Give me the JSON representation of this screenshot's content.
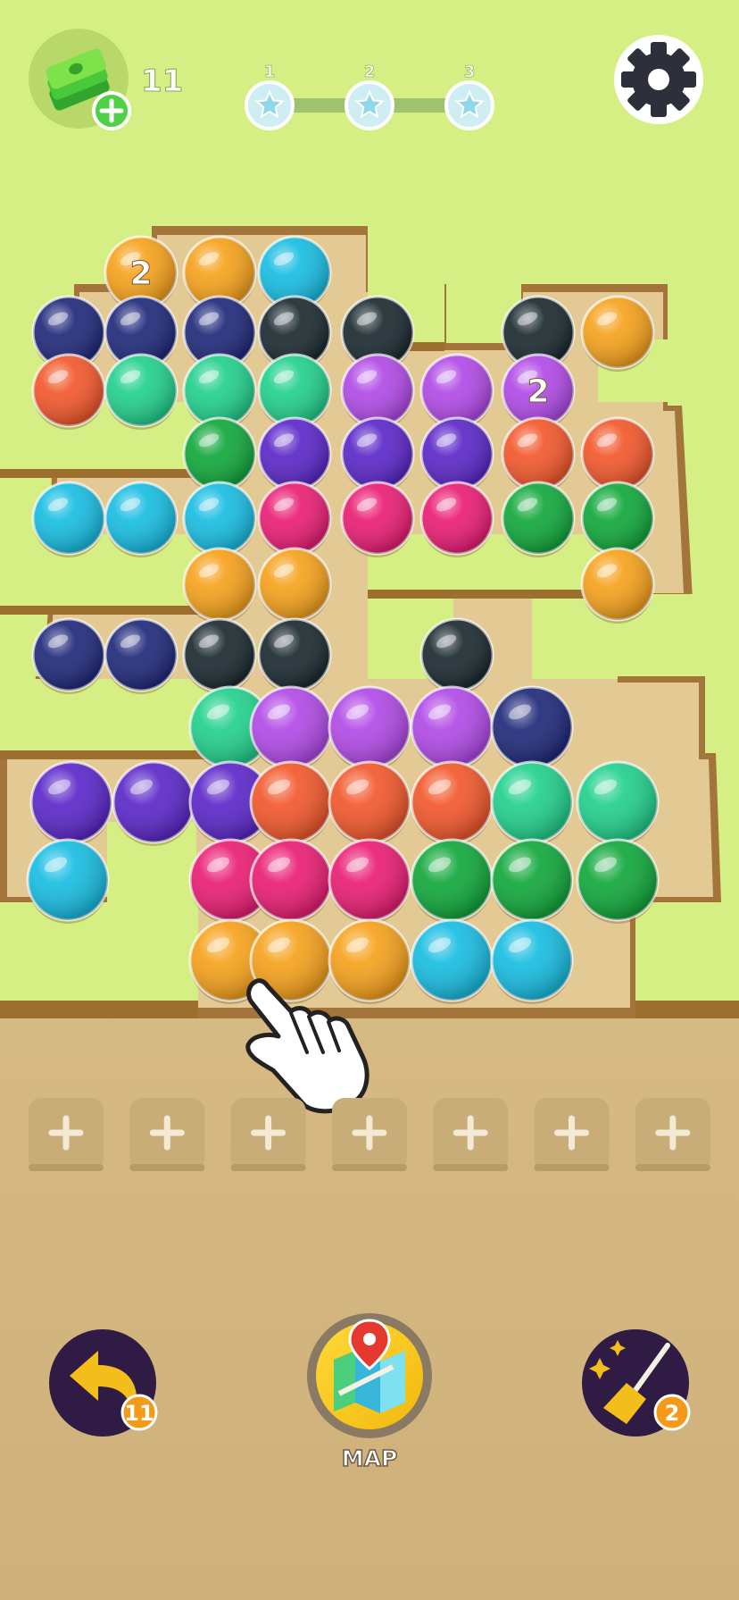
{
  "currency": {
    "amount": "11",
    "icon": "cash-stack-icon",
    "add_icon": "plus-icon"
  },
  "progress": {
    "stars": [
      {
        "label": "1"
      },
      {
        "label": "2"
      },
      {
        "label": "3"
      }
    ],
    "stars_earned": 0
  },
  "settings": {
    "icon": "gear-icon"
  },
  "board": {
    "colors": {
      "N": "#20297a",
      "K": "#1b2a30",
      "C": "#18bde2",
      "Y": "#f6a21c",
      "O": "#f2582c",
      "T": "#22d08d",
      "G": "#12a83c",
      "P": "#b14ae6",
      "V": "#5b27c8",
      "M": "#ea1e74"
    },
    "balls": [
      {
        "c": "Y",
        "row": 0,
        "col": 2,
        "badge": "2"
      },
      {
        "c": "Y",
        "row": 0,
        "col": 3
      },
      {
        "c": "C",
        "row": 0,
        "col": 4
      },
      {
        "c": "N",
        "row": 1,
        "col": 1
      },
      {
        "c": "N",
        "row": 1,
        "col": 2
      },
      {
        "c": "N",
        "row": 1,
        "col": 3
      },
      {
        "c": "K",
        "row": 1,
        "col": 4
      },
      {
        "c": "K",
        "row": 1,
        "col": 5
      },
      {
        "c": "K",
        "row": 1,
        "col": 7
      },
      {
        "c": "Y",
        "row": 1,
        "col": 8
      },
      {
        "c": "O",
        "row": 2,
        "col": 1
      },
      {
        "c": "T",
        "row": 2,
        "col": 2
      },
      {
        "c": "T",
        "row": 2,
        "col": 3
      },
      {
        "c": "T",
        "row": 2,
        "col": 4
      },
      {
        "c": "P",
        "row": 2,
        "col": 5
      },
      {
        "c": "P",
        "row": 2,
        "col": 6
      },
      {
        "c": "P",
        "row": 2,
        "col": 7,
        "badge": "2"
      },
      {
        "c": "G",
        "row": 3,
        "col": 3
      },
      {
        "c": "V",
        "row": 3,
        "col": 4
      },
      {
        "c": "V",
        "row": 3,
        "col": 5
      },
      {
        "c": "V",
        "row": 3,
        "col": 6
      },
      {
        "c": "O",
        "row": 3,
        "col": 7
      },
      {
        "c": "O",
        "row": 3,
        "col": 8
      },
      {
        "c": "C",
        "row": 4,
        "col": 1
      },
      {
        "c": "C",
        "row": 4,
        "col": 2
      },
      {
        "c": "C",
        "row": 4,
        "col": 3
      },
      {
        "c": "M",
        "row": 4,
        "col": 4
      },
      {
        "c": "M",
        "row": 4,
        "col": 5
      },
      {
        "c": "M",
        "row": 4,
        "col": 6
      },
      {
        "c": "G",
        "row": 4,
        "col": 7
      },
      {
        "c": "G",
        "row": 4,
        "col": 8
      },
      {
        "c": "Y",
        "row": 5,
        "col": 3
      },
      {
        "c": "Y",
        "row": 5,
        "col": 4
      },
      {
        "c": "Y",
        "row": 5,
        "col": 8
      },
      {
        "c": "N",
        "row": 6,
        "col": 1
      },
      {
        "c": "N",
        "row": 6,
        "col": 2
      },
      {
        "c": "K",
        "row": 6,
        "col": 3
      },
      {
        "c": "K",
        "row": 6,
        "col": 4
      },
      {
        "c": "K",
        "row": 6,
        "col": 6
      },
      {
        "c": "T",
        "row": 7,
        "col": 3
      },
      {
        "c": "P",
        "row": 7,
        "col": 4
      },
      {
        "c": "P",
        "row": 7,
        "col": 5
      },
      {
        "c": "P",
        "row": 7,
        "col": 6
      },
      {
        "c": "N",
        "row": 7,
        "col": 7
      },
      {
        "c": "V",
        "row": 8,
        "col": 1
      },
      {
        "c": "V",
        "row": 8,
        "col": 2
      },
      {
        "c": "V",
        "row": 8,
        "col": 3
      },
      {
        "c": "O",
        "row": 8,
        "col": 4
      },
      {
        "c": "O",
        "row": 8,
        "col": 5
      },
      {
        "c": "O",
        "row": 8,
        "col": 6
      },
      {
        "c": "T",
        "row": 8,
        "col": 7
      },
      {
        "c": "T",
        "row": 8,
        "col": 8
      },
      {
        "c": "C",
        "row": 9,
        "col": 1
      },
      {
        "c": "M",
        "row": 9,
        "col": 3
      },
      {
        "c": "M",
        "row": 9,
        "col": 4
      },
      {
        "c": "M",
        "row": 9,
        "col": 5
      },
      {
        "c": "G",
        "row": 9,
        "col": 6
      },
      {
        "c": "G",
        "row": 9,
        "col": 7
      },
      {
        "c": "G",
        "row": 9,
        "col": 8
      },
      {
        "c": "Y",
        "row": 10,
        "col": 3
      },
      {
        "c": "Y",
        "row": 10,
        "col": 4
      },
      {
        "c": "Y",
        "row": 10,
        "col": 5
      },
      {
        "c": "C",
        "row": 10,
        "col": 6
      },
      {
        "c": "C",
        "row": 10,
        "col": 7
      }
    ]
  },
  "tutorial": {
    "icon": "pointing-hand-icon"
  },
  "slots": {
    "count": 7,
    "icon": "plus-icon",
    "filled": 0
  },
  "bottom_bar": {
    "undo": {
      "icon": "undo-arrow-icon",
      "count": "11"
    },
    "map": {
      "icon": "map-pin-icon",
      "label": "MAP"
    },
    "clear": {
      "icon": "magic-broom-icon",
      "count": "2"
    }
  },
  "colors": {
    "background_top": "#d6ef84",
    "floor": "#dcc08c",
    "wall_dark": "#9c6f2e",
    "slot": "#c9ad78",
    "bottom_button": "#2f1b43",
    "badge": "#f49a18",
    "accent_yellow": "#f5cd1f"
  }
}
